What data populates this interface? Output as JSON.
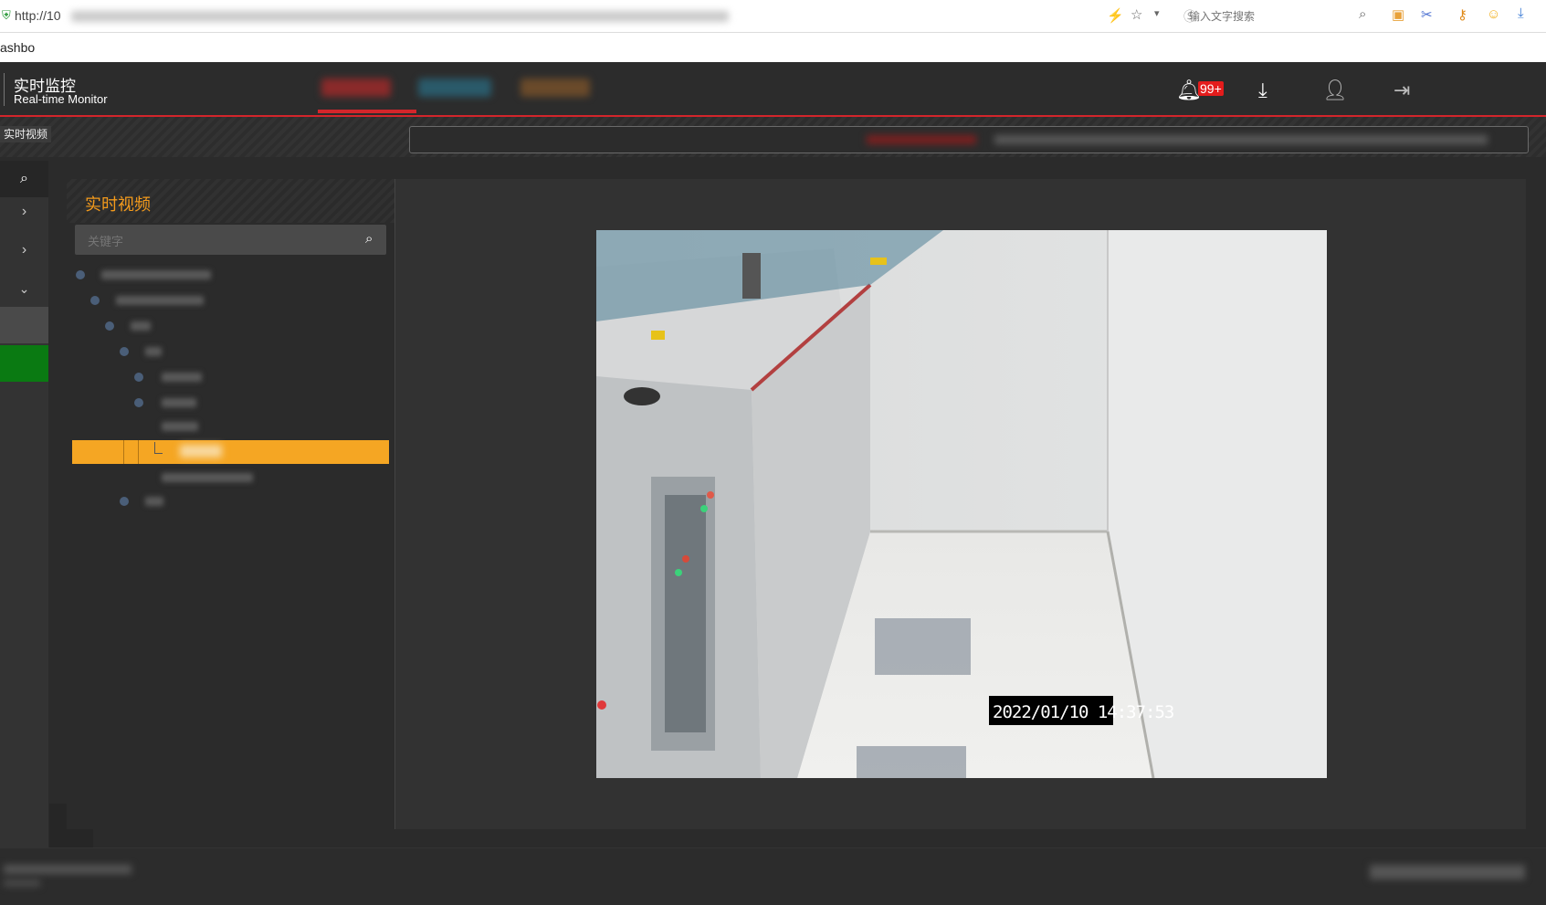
{
  "browser": {
    "url_prefix": "http://10",
    "search_placeholder": "输入文字搜索",
    "tab_text": "ashbo"
  },
  "header": {
    "title_cn": "实时监控",
    "title_en": "Real-time Monitor",
    "notification_badge": "99+",
    "accent_color": "#d3252b"
  },
  "subbar": {
    "section_label": "实时视频"
  },
  "tree": {
    "title": "实时视频",
    "search_placeholder": "关键字",
    "selected_color": "#f5a623"
  },
  "video": {
    "timestamp": "2022/01/10  14:37:53"
  }
}
